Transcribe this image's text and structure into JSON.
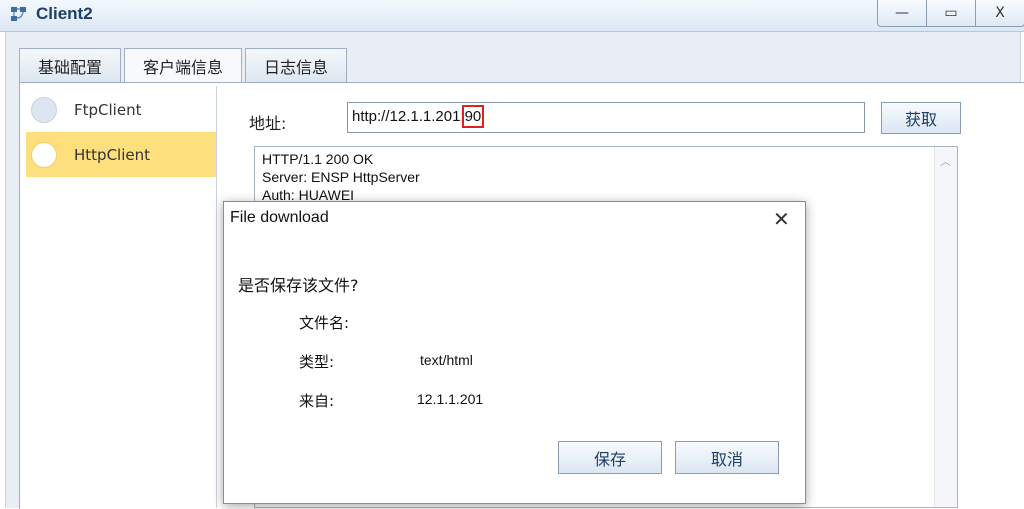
{
  "window": {
    "title": "Client2",
    "minimize_glyph": "—",
    "maximize_glyph": "▭",
    "close_glyph": "X"
  },
  "tabs": [
    {
      "label": "基础配置"
    },
    {
      "label": "客户端信息",
      "active": true
    },
    {
      "label": "日志信息"
    }
  ],
  "sidebar": {
    "items": [
      {
        "label": "FtpClient",
        "selected": false
      },
      {
        "label": "HttpClient",
        "selected": true
      }
    ]
  },
  "address": {
    "label": "地址:",
    "value_prefix": "http://12.1.1.201:",
    "value_port": "90",
    "fetch_label": "获取"
  },
  "response": {
    "lines": [
      "HTTP/1.1 200 OK",
      "Server: ENSP HttpServer",
      "Auth: HUAWEI"
    ]
  },
  "dialog": {
    "title": "File download",
    "close_glyph": "✕",
    "question": "是否保存该文件?",
    "filename_label": "文件名:",
    "filename_value": "",
    "type_label": "类型:",
    "type_value": "text/html",
    "from_label": "来自:",
    "from_value": "12.1.1.201",
    "save_label": "保存",
    "cancel_label": "取消"
  },
  "colors": {
    "selected_item": "#fddf7e",
    "highlight_box": "#e02020",
    "button_text": "#1f3f66"
  }
}
